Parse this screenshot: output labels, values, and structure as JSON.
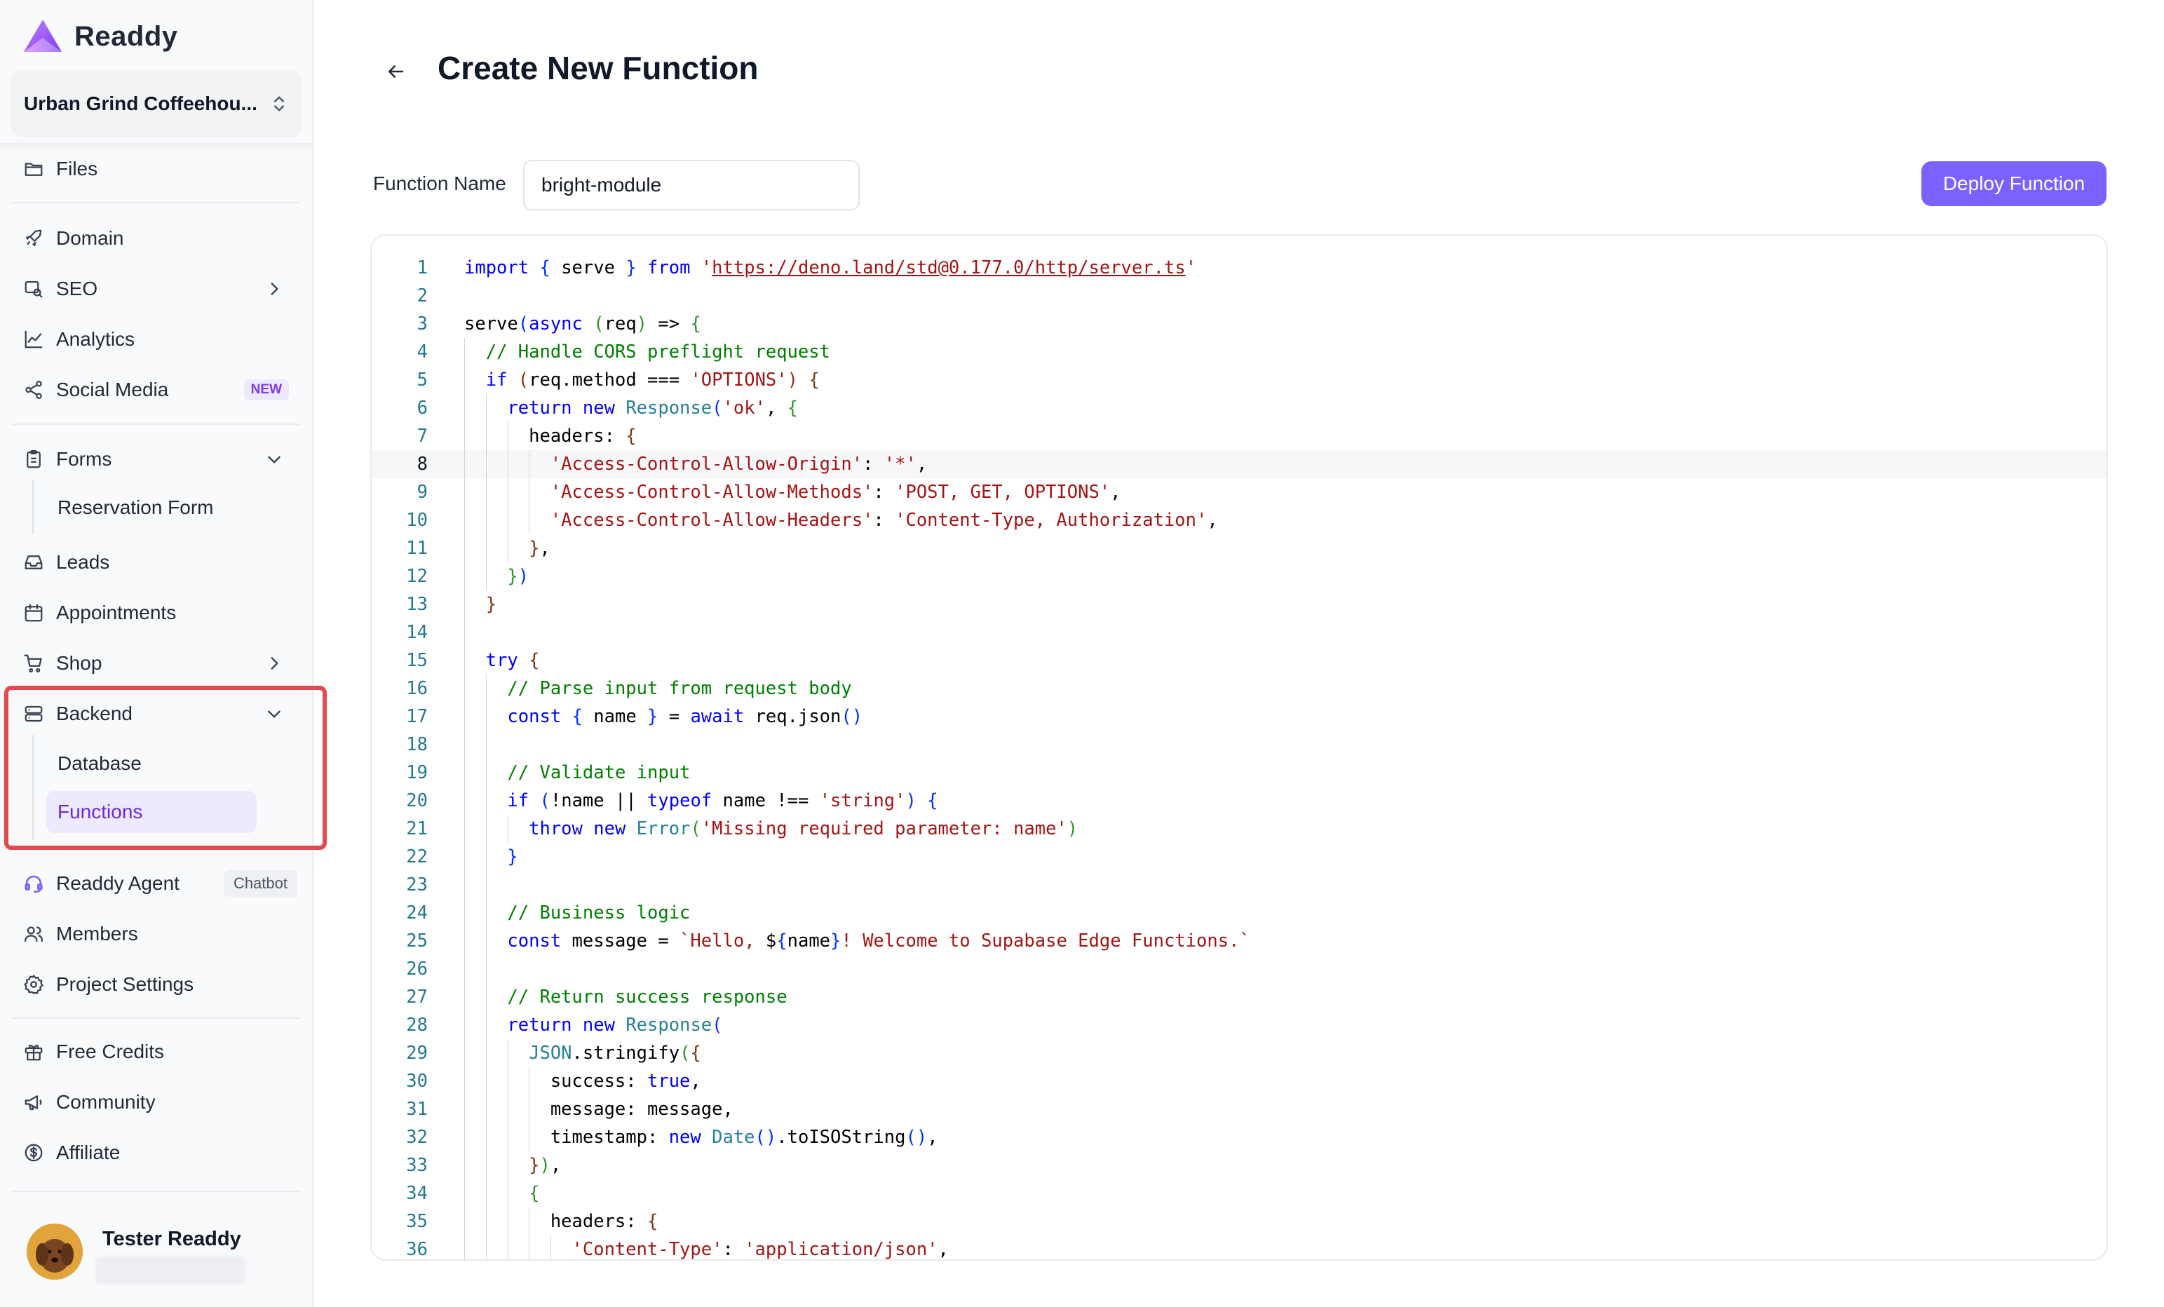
{
  "app": {
    "name": "Readdy",
    "accent": "#7b61ff"
  },
  "project": {
    "name": "Urban Grind Coffeehou..."
  },
  "sidebar": {
    "items": {
      "files": {
        "label": "Files",
        "icon": "folder-icon"
      },
      "domain": {
        "label": "Domain",
        "icon": "rocket-icon"
      },
      "seo": {
        "label": "SEO",
        "icon": "search-icon"
      },
      "analytics": {
        "label": "Analytics",
        "icon": "chart-line-icon"
      },
      "social": {
        "label": "Social Media",
        "icon": "share-icon",
        "badge": "NEW"
      },
      "forms": {
        "label": "Forms",
        "icon": "clipboard-icon",
        "children": [
          "Reservation Form"
        ]
      },
      "leads": {
        "label": "Leads",
        "icon": "inbox-icon"
      },
      "appointments": {
        "label": "Appointments",
        "icon": "calendar-icon"
      },
      "shop": {
        "label": "Shop",
        "icon": "cart-icon"
      },
      "backend": {
        "label": "Backend",
        "icon": "server-icon",
        "children": [
          "Database",
          "Functions"
        ],
        "active_child": "Functions"
      },
      "agent": {
        "label": "Readdy Agent",
        "icon": "headset-icon",
        "badge": "Chatbot"
      },
      "members": {
        "label": "Members",
        "icon": "users-icon"
      },
      "settings": {
        "label": "Project Settings",
        "icon": "gear-icon"
      },
      "credits": {
        "label": "Free Credits",
        "icon": "gift-icon"
      },
      "community": {
        "label": "Community",
        "icon": "megaphone-icon"
      },
      "affiliate": {
        "label": "Affiliate",
        "icon": "dollar-icon"
      }
    }
  },
  "user": {
    "name": "Tester Readdy"
  },
  "page": {
    "title": "Create New Function",
    "function_name_label": "Function Name",
    "function_name_value": "bright-module",
    "deploy_label": "Deploy Function"
  },
  "editor": {
    "current_line": 8,
    "lines": [
      "import { serve } from 'https://deno.land/std@0.177.0/http/server.ts'",
      "",
      "serve(async (req) => {",
      "  // Handle CORS preflight request",
      "  if (req.method === 'OPTIONS') {",
      "    return new Response('ok', {",
      "      headers: {",
      "        'Access-Control-Allow-Origin': '*',",
      "        'Access-Control-Allow-Methods': 'POST, GET, OPTIONS',",
      "        'Access-Control-Allow-Headers': 'Content-Type, Authorization',",
      "      },",
      "    })",
      "  }",
      "",
      "  try {",
      "    // Parse input from request body",
      "    const { name } = await req.json()",
      "",
      "    // Validate input",
      "    if (!name || typeof name !== 'string') {",
      "      throw new Error('Missing required parameter: name')",
      "    }",
      "",
      "    // Business logic",
      "    const message = `Hello, ${name}! Welcome to Supabase Edge Functions.`",
      "",
      "    // Return success response",
      "    return new Response(",
      "      JSON.stringify({",
      "        success: true,",
      "        message: message,",
      "        timestamp: new Date().toISOString(),",
      "      }),",
      "      {",
      "        headers: {",
      "          'Content-Type': 'application/json',"
    ]
  }
}
